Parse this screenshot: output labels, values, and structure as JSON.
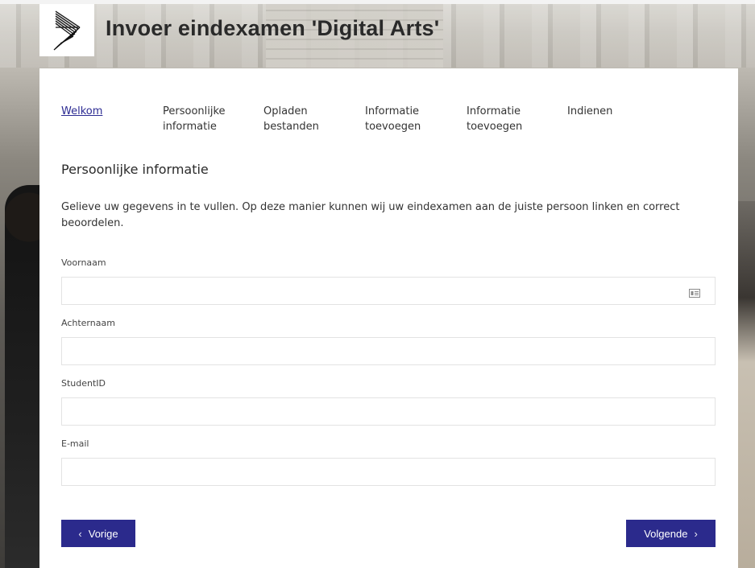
{
  "header": {
    "title": "Invoer eindexamen 'Digital Arts'"
  },
  "steps": [
    {
      "label": "Welkom",
      "active": true
    },
    {
      "label": "Persoonlijke informatie",
      "active": false
    },
    {
      "label": "Opladen bestanden",
      "active": false
    },
    {
      "label": "Informatie toevoegen",
      "active": false
    },
    {
      "label": "Informatie toevoegen",
      "active": false
    },
    {
      "label": "Indienen",
      "active": false
    }
  ],
  "section": {
    "title": "Persoonlijke informatie",
    "intro": "Gelieve uw gegevens in te vullen. Op deze manier kunnen wij uw eindexamen aan de juiste persoon linken en correct beoordelen."
  },
  "fields": {
    "voornaam": {
      "label": "Voornaam",
      "value": ""
    },
    "achternaam": {
      "label": "Achternaam",
      "value": ""
    },
    "studentid": {
      "label": "StudentID",
      "value": ""
    },
    "email": {
      "label": "E-mail",
      "value": ""
    }
  },
  "buttons": {
    "prev_label": "Vorige",
    "next_label": "Volgende",
    "prev_icon": "chevron-left-icon",
    "next_icon": "chevron-right-icon"
  },
  "colors": {
    "accent": "#2b2a8c",
    "active_link": "#2b2a92"
  }
}
